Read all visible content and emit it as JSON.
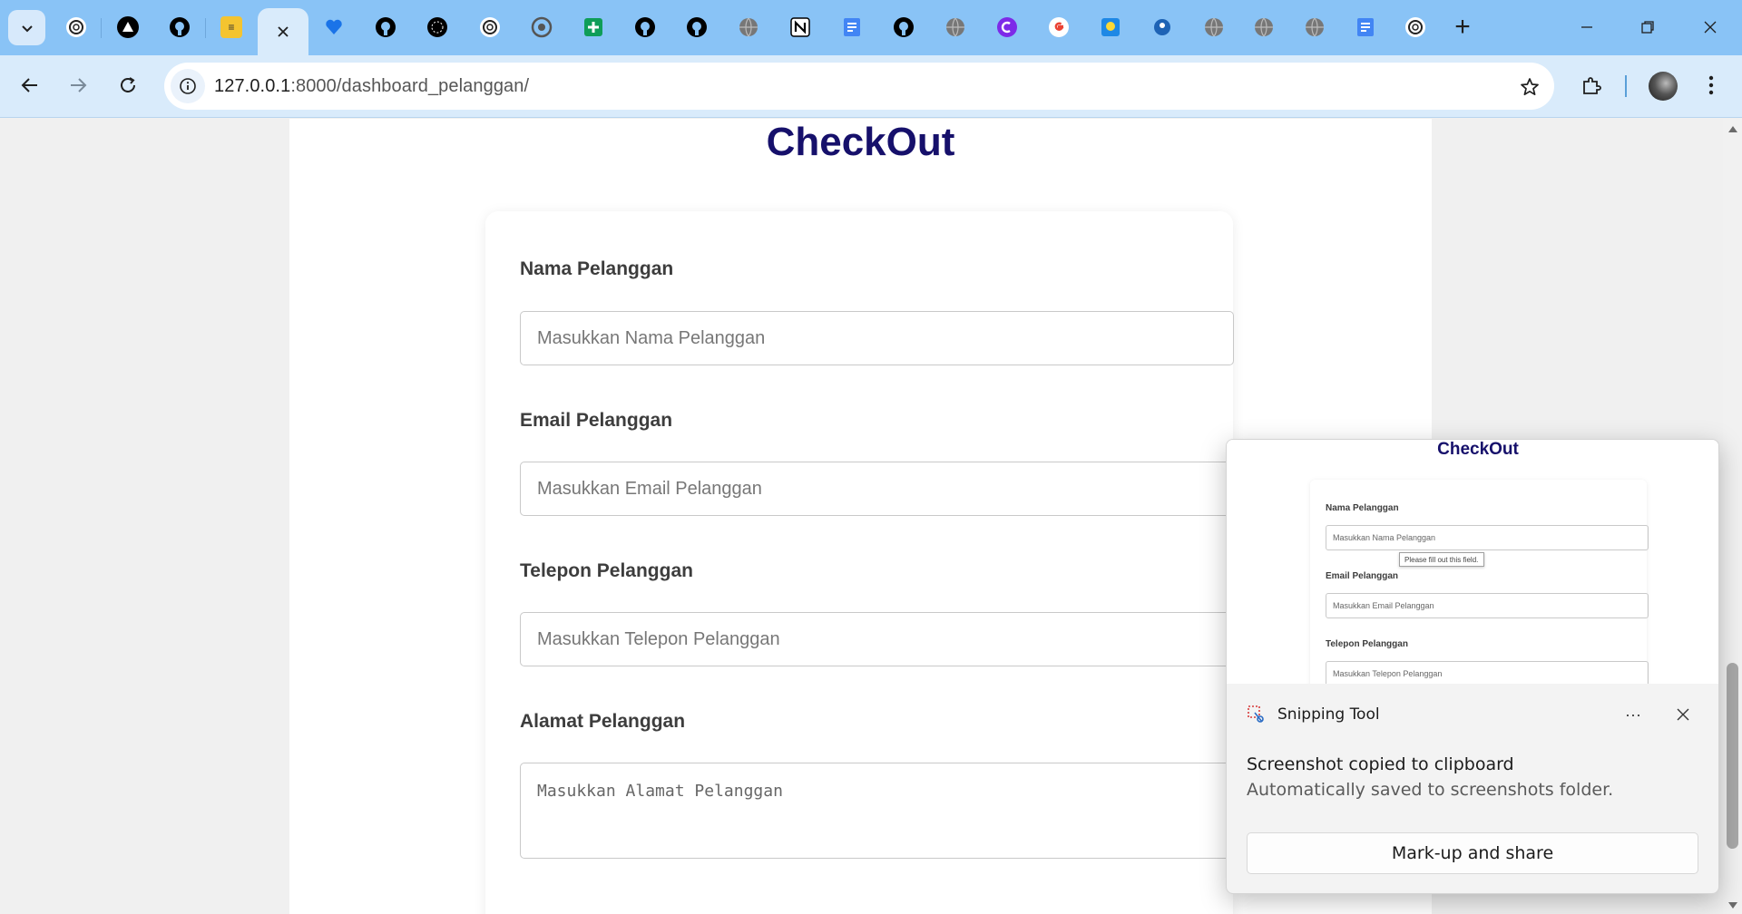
{
  "browser": {
    "tabs": [
      {
        "icon": "chatgpt-icon",
        "color": "#ffffff"
      },
      {
        "icon": "vercel-triangle-icon",
        "color": "#000000"
      },
      {
        "icon": "github-icon",
        "color": "#000000"
      },
      {
        "icon": "stack-icon",
        "color": "#f4c430"
      },
      {
        "icon": "close-icon",
        "active": true
      },
      {
        "icon": "heart-icon",
        "color": "#1a73e8"
      },
      {
        "icon": "github-icon",
        "color": "#000000"
      },
      {
        "icon": "perplexity-icon",
        "color": "#000000"
      },
      {
        "icon": "chatgpt-icon",
        "color": "#ffffff"
      },
      {
        "icon": "chrome-icon",
        "color": "#555555"
      },
      {
        "icon": "google-sheets-icon",
        "color": "#0f9d58"
      },
      {
        "icon": "github-icon",
        "color": "#000000"
      },
      {
        "icon": "github-icon",
        "color": "#000000"
      },
      {
        "icon": "globe-icon",
        "color": "#777777"
      },
      {
        "icon": "notion-icon",
        "color": "#000000"
      },
      {
        "icon": "google-docs-icon",
        "color": "#4285f4"
      },
      {
        "icon": "github-icon",
        "color": "#000000"
      },
      {
        "icon": "globe-icon",
        "color": "#777777"
      },
      {
        "icon": "canva-icon",
        "color": "#7d2ae8"
      },
      {
        "icon": "google-icon",
        "color": "#ea4335"
      },
      {
        "icon": "kemdikbud-icon",
        "color": "#1e88e5"
      },
      {
        "icon": "blue-circle-icon",
        "color": "#1e63b5"
      },
      {
        "icon": "globe-icon",
        "color": "#777777"
      },
      {
        "icon": "globe-icon",
        "color": "#777777"
      },
      {
        "icon": "globe-icon",
        "color": "#777777"
      },
      {
        "icon": "google-docs-icon",
        "color": "#4285f4"
      },
      {
        "icon": "chatgpt-icon",
        "color": "#ffffff"
      }
    ],
    "new_tab_symbol": "+",
    "url_host": "127.0.0.1",
    "url_path": ":8000/dashboard_pelanggan/"
  },
  "page": {
    "title": "CheckOut",
    "title_color": "#16106b",
    "fields": {
      "nama": {
        "label": "Nama Pelanggan",
        "placeholder": "Masukkan Nama Pelanggan"
      },
      "email": {
        "label": "Email Pelanggan",
        "placeholder": "Masukkan Email Pelanggan"
      },
      "telepon": {
        "label": "Telepon Pelanggan",
        "placeholder": "Masukkan Telepon Pelanggan"
      },
      "alamat": {
        "label": "Alamat Pelanggan",
        "placeholder": "Masukkan Alamat Pelanggan"
      }
    }
  },
  "toast": {
    "app_name": "Snipping Tool",
    "more_label": "···",
    "message": "Screenshot copied to clipboard",
    "sub_message": "Automatically saved to screenshots folder.",
    "button_label": "Mark-up and share",
    "preview": {
      "title": "CheckOut",
      "nama_label": "Nama Pelanggan",
      "nama_placeholder": "Masukkan Nama Pelanggan",
      "tooltip": "Please fill out this field.",
      "email_label": "Email Pelanggan",
      "email_placeholder": "Masukkan Email Pelanggan",
      "telepon_label": "Telepon Pelanggan",
      "telepon_placeholder": "Masukkan Telepon Pelanggan"
    }
  }
}
